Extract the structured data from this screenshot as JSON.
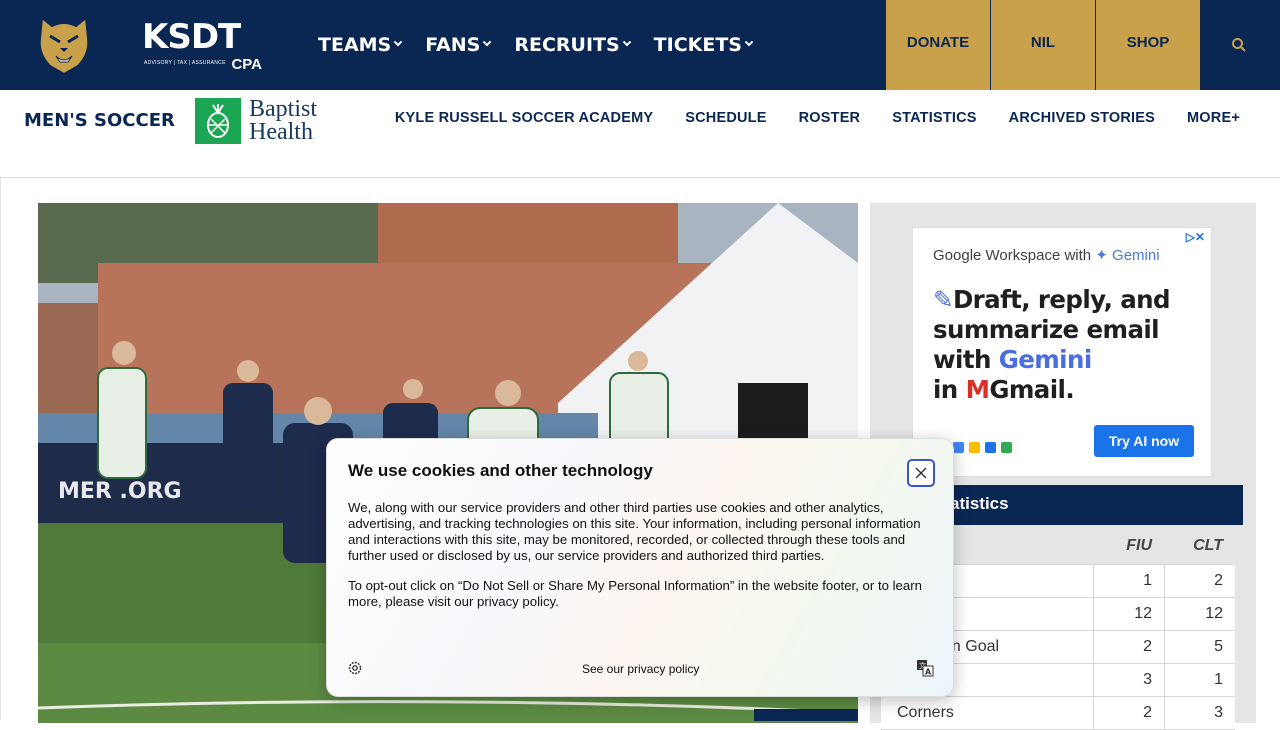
{
  "header": {
    "sponsor_logo": {
      "big": "KSDT",
      "small": "ADVISORY | TAX | ASSURANCE",
      "suffix": "CPA"
    },
    "nav": [
      "TEAMS",
      "FANS",
      "RECRUITS",
      "TICKETS"
    ],
    "gold_buttons": [
      "DONATE",
      "NIL",
      "SHOP"
    ],
    "icons": {
      "logo": "panther-logo-icon",
      "search": "search-icon",
      "dropdown": "chevron-down-icon"
    }
  },
  "subheader": {
    "sport": "MEN'S SOCCER",
    "sponsor_line1": "Baptist",
    "sponsor_line2": "Health",
    "nav": [
      "KYLE RUSSELL SOCCER ACADEMY",
      "SCHEDULE",
      "ROSTER",
      "STATISTICS",
      "ARCHIVED STORIES",
      "MORE+"
    ]
  },
  "ad": {
    "brand": "Google Workspace with",
    "brand_gemini": "✦ Gemini",
    "headline_1": "Draft, reply, and summarize email with ",
    "headline_gemini": "Gemini",
    "headline_2": "in",
    "headline_gmail": "Gmail.",
    "cta": "Try AI now"
  },
  "stats": {
    "title": "Statistics",
    "teams": [
      "FIU",
      "CLT"
    ],
    "rows": [
      {
        "label": "",
        "fiu": "1",
        "clt": "2"
      },
      {
        "label": "",
        "fiu": "12",
        "clt": "12"
      },
      {
        "label": "on Goal",
        "fiu": "2",
        "clt": "5"
      },
      {
        "label": "",
        "fiu": "3",
        "clt": "1"
      },
      {
        "label": "Corners",
        "fiu": "2",
        "clt": "3"
      }
    ]
  },
  "cookie": {
    "title": "We use cookies and other technology",
    "para1": "We, along with our service providers and other third parties use cookies and other analytics, advertising, and tracking technologies on this site. Your information, including personal information and interactions with this site, may be monitored, recorded, or collected through these tools and further used or disclosed by us, our service providers and authorized third parties.",
    "para2": "To opt-out click on “Do Not Sell or Share My Personal Information” in the website footer, or to learn more, please visit our privacy policy.",
    "policy_link": "See our privacy policy",
    "icons": {
      "close": "close-icon",
      "settings": "gear-icon",
      "language": "translate-icon"
    }
  },
  "colors": {
    "navy": "#0a2652",
    "gold": "#c9a14a",
    "cta_blue": "#1a73e8"
  }
}
